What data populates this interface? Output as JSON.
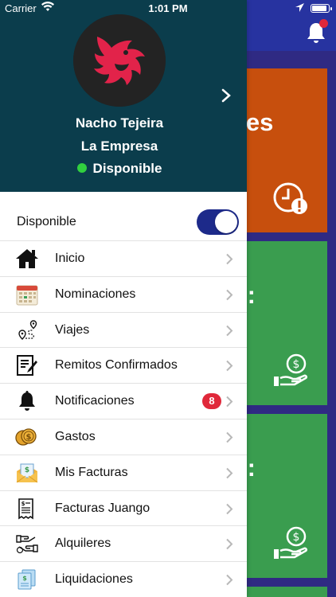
{
  "status_bar": {
    "carrier": "Carrier",
    "time": "1:01 PM"
  },
  "profile": {
    "name": "Nacho Tejeira",
    "company": "La Empresa",
    "status": "Disponible",
    "status_color": "#31d03f",
    "header_color": "#0b3d4c"
  },
  "availability": {
    "label": "Disponible",
    "on": true,
    "toggle_color": "#1d2a8a"
  },
  "menu": [
    {
      "label": "Inicio",
      "icon": "home-icon"
    },
    {
      "label": "Nominaciones",
      "icon": "calendar-icon"
    },
    {
      "label": "Viajes",
      "icon": "route-pin-icon"
    },
    {
      "label": "Remitos Confirmados",
      "icon": "document-pen-icon"
    },
    {
      "label": "Notificaciones",
      "icon": "bell-icon",
      "badge": "8"
    },
    {
      "label": "Gastos",
      "icon": "coins-icon"
    },
    {
      "label": "Mis Facturas",
      "icon": "invoice-envelope-icon"
    },
    {
      "label": "Facturas Juango",
      "icon": "receipt-icon"
    },
    {
      "label": "Alquileres",
      "icon": "hand-exchange-icon"
    },
    {
      "label": "Liquidaciones",
      "icon": "documents-icon"
    }
  ],
  "background": {
    "tile1_text": "nes",
    "tile2_text": "S:",
    "tile3_text": "S:",
    "colors": {
      "header": "#2733a0",
      "orange": "#c74f0d",
      "green": "#3a9d4f",
      "content": "#2f2a83"
    }
  }
}
